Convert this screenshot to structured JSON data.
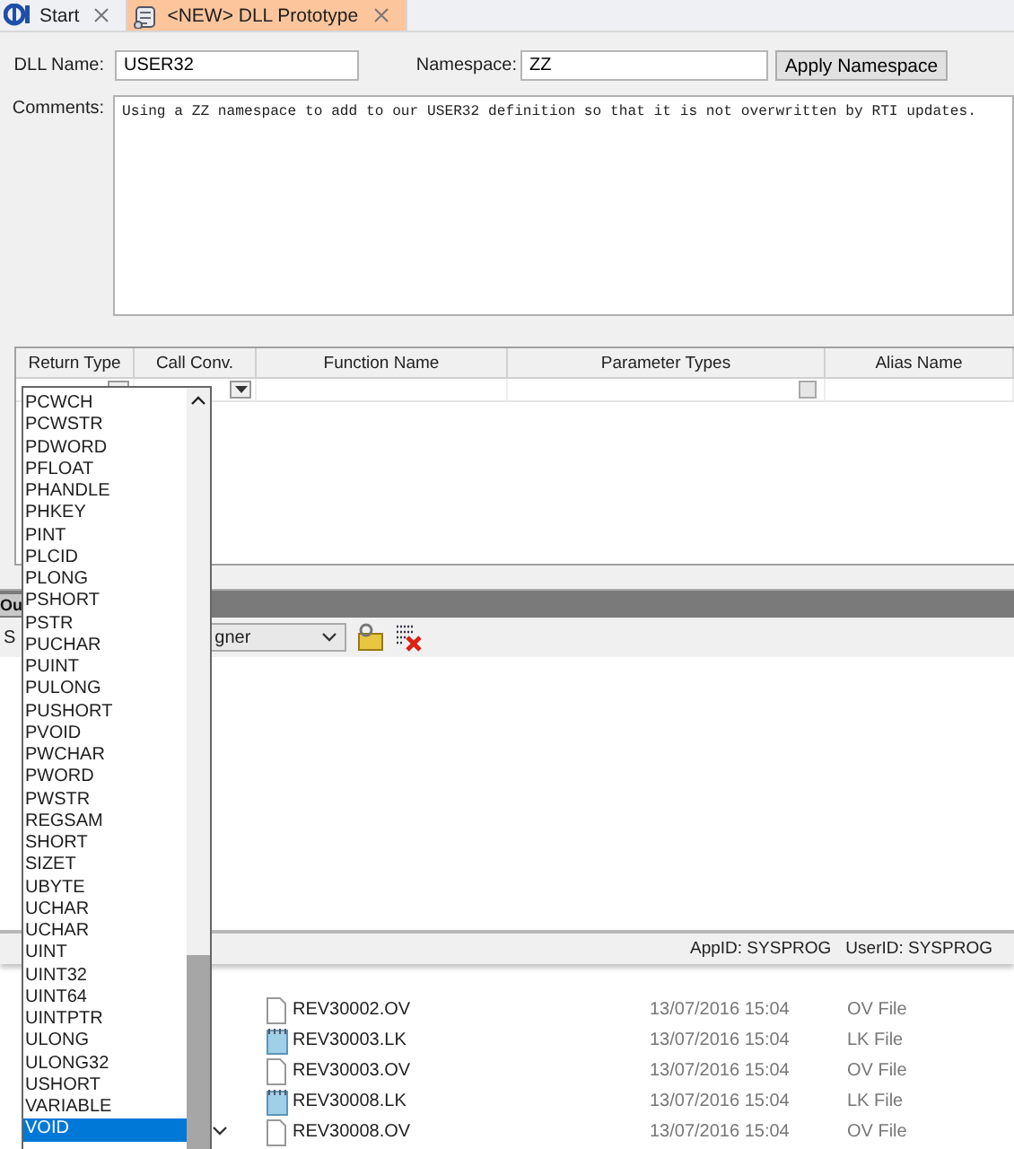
{
  "tabs": [
    {
      "label": "Start",
      "selected": false,
      "kind": "app"
    },
    {
      "label": "<NEW> DLL Prototype",
      "selected": true,
      "kind": "scroll"
    }
  ],
  "form": {
    "dll_name": {
      "label": "DLL Name:",
      "value": "USER32"
    },
    "namespace": {
      "label": "Namespace:",
      "value": "ZZ"
    },
    "apply_button": "Apply Namespace",
    "comments": {
      "label": "Comments:",
      "value": "Using a ZZ namespace to add to our USER32 definition so that it is not overwritten by RTI updates."
    }
  },
  "grid": {
    "columns": [
      {
        "label": "Return Type",
        "kind": "dropdown"
      },
      {
        "label": "Call Conv.",
        "kind": "dropdown"
      },
      {
        "label": "Function Name",
        "kind": "text"
      },
      {
        "label": "Parameter Types",
        "kind": "button"
      },
      {
        "label": "Alias Name",
        "kind": "text"
      }
    ]
  },
  "output_panel": {
    "tab_label": "Ou",
    "toolbar_label": "S",
    "combo_value": "gner"
  },
  "status_bar": {
    "app_id": "AppID: SYSPROG",
    "user_id": "UserID: SYSPROG"
  },
  "file_list": {
    "rows": [
      {
        "name": "REV30002.OV",
        "date": "13/07/2016 15:04",
        "type": "OV File",
        "kind": "plain"
      },
      {
        "name": "REV30003.LK",
        "date": "13/07/2016 15:04",
        "type": "LK File",
        "kind": "notepad"
      },
      {
        "name": "REV30003.OV",
        "date": "13/07/2016 15:04",
        "type": "OV File",
        "kind": "plain"
      },
      {
        "name": "REV30008.LK",
        "date": "13/07/2016 15:04",
        "type": "LK File",
        "kind": "notepad"
      },
      {
        "name": "REV30008.OV",
        "date": "13/07/2016 15:04",
        "type": "OV File",
        "kind": "plain"
      }
    ]
  },
  "dropdown": {
    "items": [
      {
        "label": "PCWCH",
        "selected": false
      },
      {
        "label": "PCWSTR",
        "selected": false
      },
      {
        "label": "PDWORD",
        "selected": false
      },
      {
        "label": "PFLOAT",
        "selected": false
      },
      {
        "label": "PHANDLE",
        "selected": false
      },
      {
        "label": "PHKEY",
        "selected": false
      },
      {
        "label": "PINT",
        "selected": false
      },
      {
        "label": "PLCID",
        "selected": false
      },
      {
        "label": "PLONG",
        "selected": false
      },
      {
        "label": "PSHORT",
        "selected": false
      },
      {
        "label": "PSTR",
        "selected": false
      },
      {
        "label": "PUCHAR",
        "selected": false
      },
      {
        "label": "PUINT",
        "selected": false
      },
      {
        "label": "PULONG",
        "selected": false
      },
      {
        "label": "PUSHORT",
        "selected": false
      },
      {
        "label": "PVOID",
        "selected": false
      },
      {
        "label": "PWCHAR",
        "selected": false
      },
      {
        "label": "PWORD",
        "selected": false
      },
      {
        "label": "PWSTR",
        "selected": false
      },
      {
        "label": "REGSAM",
        "selected": false
      },
      {
        "label": "SHORT",
        "selected": false
      },
      {
        "label": "SIZET",
        "selected": false
      },
      {
        "label": "UBYTE",
        "selected": false
      },
      {
        "label": "UCHAR",
        "selected": false
      },
      {
        "label": "UCHAR",
        "selected": false
      },
      {
        "label": "UINT",
        "selected": false
      },
      {
        "label": "UINT32",
        "selected": false
      },
      {
        "label": "UINT64",
        "selected": false
      },
      {
        "label": "UINTPTR",
        "selected": false
      },
      {
        "label": "ULONG",
        "selected": false
      },
      {
        "label": "ULONG32",
        "selected": false
      },
      {
        "label": "USHORT",
        "selected": false
      },
      {
        "label": "VARIABLE",
        "selected": false
      },
      {
        "label": "VOID",
        "selected": true
      }
    ]
  }
}
